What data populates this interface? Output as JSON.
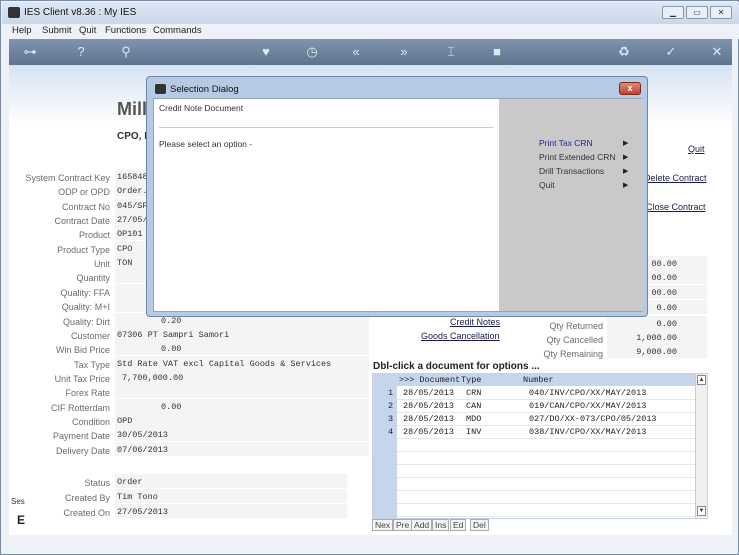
{
  "window": {
    "title": "IES Client v8.36 : My IES"
  },
  "menu": [
    "Help",
    "Submit",
    "Quit",
    "Functions",
    "Commands"
  ],
  "toolbar_icons": [
    "key-icon",
    "help-icon",
    "search-icon",
    "heart-icon",
    "clock-icon",
    "rewind-icon",
    "forward-icon",
    "cursor-icon",
    "square-icon",
    "recycle-icon",
    "check-icon",
    "close-icon"
  ],
  "toolbar_glyphs": [
    "⊶",
    "?",
    "⚲",
    "♥",
    "◷",
    "«",
    "»",
    "⌶",
    "■",
    "♻",
    "✓",
    "✕"
  ],
  "header": {
    "company": "Mill",
    "subtitle": "CPO, K"
  },
  "actions": {
    "quit": "Quit",
    "delete": "Delete Contract",
    "close": "Close Contract"
  },
  "fields": [
    {
      "label": "System Contract Key",
      "value": "165848"
    },
    {
      "label": "ODP or OPD",
      "value": "Order."
    },
    {
      "label": "Contract No",
      "value": "045/SP"
    },
    {
      "label": "Contract Date",
      "value": "27/05/"
    },
    {
      "label": "Product",
      "value": "OP101"
    },
    {
      "label": "Product Type",
      "value": "CPO"
    },
    {
      "label": "Unit",
      "value": "TON"
    },
    {
      "label": "Quantity",
      "value": ""
    },
    {
      "label": "Quality: FFA",
      "value": ""
    },
    {
      "label": "Quality: M+I",
      "value": ""
    },
    {
      "label": "Quality: Dirt",
      "value": "0.20"
    },
    {
      "label": "Customer",
      "value": "07306 PT Sampri Samori"
    },
    {
      "label": "Win Bid Price",
      "value": "0.00"
    },
    {
      "label": "Tax Type",
      "value": "Std Rate VAT excl Capital Goods & Services"
    },
    {
      "label": "Unit Tax Price",
      "value": "7,700,000.00"
    },
    {
      "label": "Forex Rate",
      "value": ""
    },
    {
      "label": "CIF Rotterdam",
      "value": "0.00"
    },
    {
      "label": "Condition",
      "value": "OPD"
    },
    {
      "label": "Payment Date",
      "value": "30/05/2013"
    },
    {
      "label": "Delivery Date",
      "value": "07/06/2013"
    }
  ],
  "status_fields": [
    {
      "label": "Status",
      "value": "Order"
    },
    {
      "label": "Created By",
      "value": "Tim Tono"
    },
    {
      "label": "Created On",
      "value": "27/05/2013"
    }
  ],
  "right_values": [
    "00.00",
    "00.00",
    "00.00",
    "0.00"
  ],
  "quantities": [
    {
      "label": "Qty Returned",
      "value": "0.00"
    },
    {
      "label": "Qty Cancelled",
      "value": "1,000.00"
    },
    {
      "label": "Qty Remaining",
      "value": "9,000.00"
    }
  ],
  "links": {
    "credit_notes": "Credit Notes",
    "goods_cancellation": "Goods Cancellation"
  },
  "grid": {
    "caption": "Dbl-click a document for options ...",
    "headers": {
      "doc": ">>> Document",
      "type": "Type",
      "number": "Number"
    },
    "rows": [
      {
        "n": "1",
        "date": "28/05/2013",
        "type": "CRN",
        "number": "040/INV/CPO/XX/MAY/2013"
      },
      {
        "n": "2",
        "date": "28/05/2013",
        "type": "CAN",
        "number": "019/CAN/CPO/XX/MAY/2013"
      },
      {
        "n": "3",
        "date": "28/05/2013",
        "type": "MDO",
        "number": "027/DO/XX-073/CPO/05/2013"
      },
      {
        "n": "4",
        "date": "28/05/2013",
        "type": "INV",
        "number": "038/INV/CPO/XX/MAY/2013"
      }
    ],
    "nav": [
      "Nex",
      "Pre",
      "Add",
      "Ins",
      "Ed",
      "Del"
    ]
  },
  "left_fragments": {
    "ses": "Ses",
    "e": "E"
  },
  "dialog": {
    "title": "Selection Dialog",
    "subtitle": "Credit Note Document",
    "prompt": "Please select an option -",
    "options": [
      "Print Tax CRN",
      "Print Extended CRN",
      "Drill Transactions",
      "Quit"
    ],
    "close_label": "x"
  }
}
